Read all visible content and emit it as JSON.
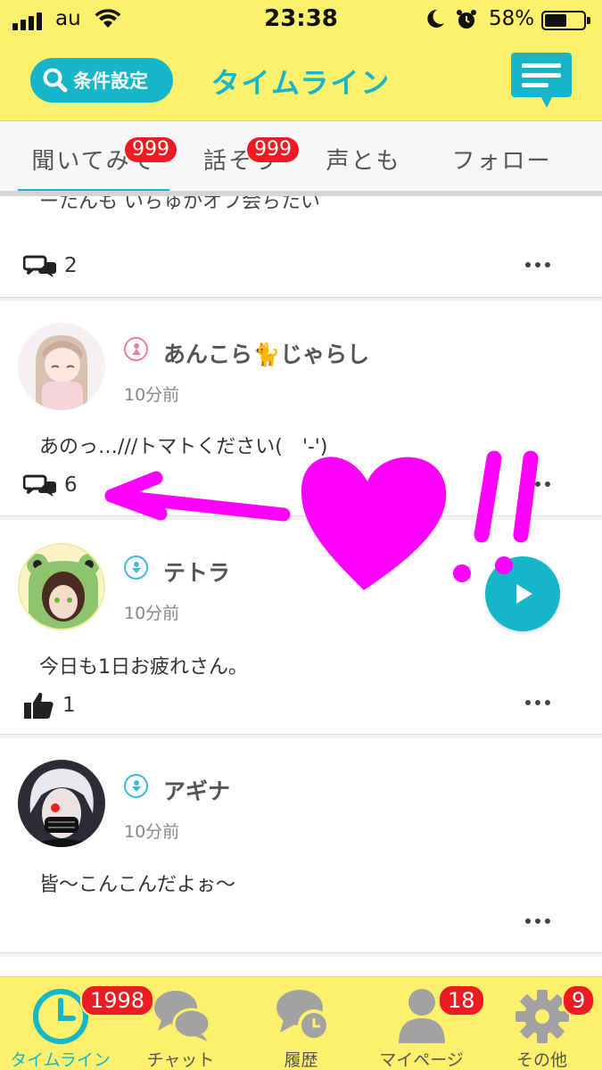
{
  "status_bar": {
    "carrier": "au",
    "time": "23:38",
    "battery_percent": "58%",
    "battery_level": 0.58
  },
  "header": {
    "filter_label": "条件設定",
    "title": "タイムライン"
  },
  "tabs": [
    {
      "label": "聞いてみて",
      "badge": "999",
      "active": true
    },
    {
      "label": "話そう",
      "badge": "999",
      "active": false
    },
    {
      "label": "声とも",
      "badge": "",
      "active": false
    },
    {
      "label": "フォロー",
      "badge": "",
      "active": false
    }
  ],
  "posts": [
    {
      "text": "ーたんも いちゅかオフ会ちたい",
      "count": "2",
      "reaction_type": "comment"
    },
    {
      "username": "あんこら🐈じゃらし",
      "time": "10分前",
      "text": "あのっ…///トマトください(　'-')",
      "count": "6",
      "reaction_type": "comment",
      "voice_type": "female"
    },
    {
      "username": "テトラ",
      "time": "10分前",
      "text": "今日も1日お疲れさん。",
      "count": "1",
      "reaction_type": "like",
      "voice_type": "male"
    },
    {
      "username": "アギナ",
      "time": "10分前",
      "text": "皆〜こんこんだよぉ〜",
      "count": "",
      "reaction_type": "none",
      "voice_type": "male"
    }
  ],
  "bottom_nav": [
    {
      "label": "タイムライン",
      "icon": "clock-icon",
      "badge": "1998",
      "active": true
    },
    {
      "label": "チャット",
      "icon": "chat-bubbles-icon",
      "badge": "",
      "active": false
    },
    {
      "label": "履歴",
      "icon": "history-icon",
      "badge": "",
      "active": false
    },
    {
      "label": "マイページ",
      "icon": "person-icon",
      "badge": "18",
      "active": false
    },
    {
      "label": "その他",
      "icon": "gear-icon",
      "badge": "9",
      "active": false
    }
  ],
  "colors": {
    "header_bg": "#fdf06d",
    "accent": "#16b6c9",
    "badge": "#ee1b23",
    "annotation_magenta": "#ff00ff",
    "female_icon": "#f07f9a",
    "male_icon": "#3db8de"
  }
}
